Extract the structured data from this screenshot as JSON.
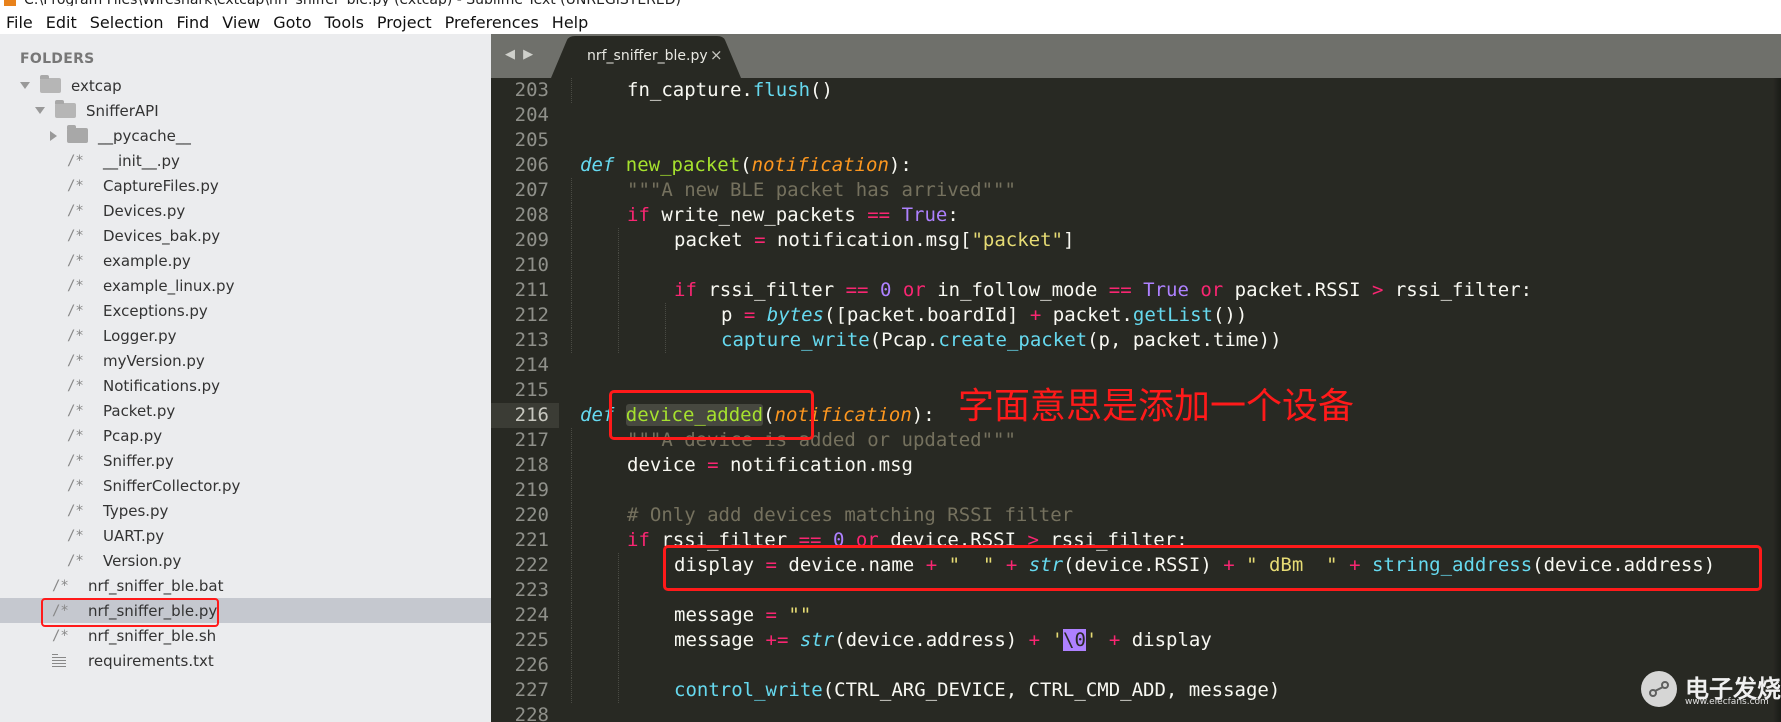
{
  "window": {
    "title": "C:\\Program Files\\Wireshark\\extcap\\nrf_sniffer_ble.py (extcap) - Sublime Text (UNREGISTERED)"
  },
  "menu": [
    "File",
    "Edit",
    "Selection",
    "Find",
    "View",
    "Goto",
    "Tools",
    "Project",
    "Preferences",
    "Help"
  ],
  "sidebar": {
    "heading": "FOLDERS",
    "items": [
      {
        "label": "extcap",
        "type": "folder-open",
        "depth": 0
      },
      {
        "label": "SnifferAPI",
        "type": "folder-open",
        "depth": 1
      },
      {
        "label": "__pycache__",
        "type": "folder-closed",
        "depth": 2
      },
      {
        "label": "__init__.py",
        "type": "file",
        "depth": 2
      },
      {
        "label": "CaptureFiles.py",
        "type": "file",
        "depth": 2
      },
      {
        "label": "Devices.py",
        "type": "file",
        "depth": 2
      },
      {
        "label": "Devices_bak.py",
        "type": "file",
        "depth": 2
      },
      {
        "label": "example.py",
        "type": "file",
        "depth": 2
      },
      {
        "label": "example_linux.py",
        "type": "file",
        "depth": 2
      },
      {
        "label": "Exceptions.py",
        "type": "file",
        "depth": 2
      },
      {
        "label": "Logger.py",
        "type": "file",
        "depth": 2
      },
      {
        "label": "myVersion.py",
        "type": "file",
        "depth": 2
      },
      {
        "label": "Notifications.py",
        "type": "file",
        "depth": 2
      },
      {
        "label": "Packet.py",
        "type": "file",
        "depth": 2
      },
      {
        "label": "Pcap.py",
        "type": "file",
        "depth": 2
      },
      {
        "label": "Sniffer.py",
        "type": "file",
        "depth": 2
      },
      {
        "label": "SnifferCollector.py",
        "type": "file",
        "depth": 2
      },
      {
        "label": "Types.py",
        "type": "file",
        "depth": 2
      },
      {
        "label": "UART.py",
        "type": "file",
        "depth": 2
      },
      {
        "label": "Version.py",
        "type": "file",
        "depth": 2
      },
      {
        "label": "nrf_sniffer_ble.bat",
        "type": "file",
        "depth": 1
      },
      {
        "label": "nrf_sniffer_ble.py",
        "type": "file",
        "depth": 1,
        "selected": true
      },
      {
        "label": "nrf_sniffer_ble.sh",
        "type": "file",
        "depth": 1
      },
      {
        "label": "requirements.txt",
        "type": "text",
        "depth": 1
      }
    ],
    "file_icon_glyph": "/*"
  },
  "editor": {
    "nav_arrows": "◀ ▶",
    "tab": {
      "title": "nrf_sniffer_ble.py",
      "close": "×"
    },
    "current_line": 216,
    "lines": [
      {
        "n": 203,
        "indent": 1,
        "tokens": [
          [
            "",
            "fn_capture."
          ],
          [
            "call",
            "flush"
          ],
          [
            "",
            "()"
          ]
        ]
      },
      {
        "n": 204,
        "indent": 0,
        "tokens": []
      },
      {
        "n": 205,
        "indent": 0,
        "tokens": []
      },
      {
        "n": 206,
        "indent": 0,
        "tokens": [
          [
            "def",
            "def"
          ],
          [
            "",
            " "
          ],
          [
            "fn",
            "new_packet"
          ],
          [
            "",
            "("
          ],
          [
            "param",
            "notification"
          ],
          [
            "",
            "):"
          ]
        ]
      },
      {
        "n": 207,
        "indent": 1,
        "tokens": [
          [
            "cmt",
            "\"\"\"A new BLE packet has arrived\"\"\""
          ]
        ]
      },
      {
        "n": 208,
        "indent": 1,
        "tokens": [
          [
            "kw",
            "if"
          ],
          [
            "",
            " write_new_packets "
          ],
          [
            "kw",
            "=="
          ],
          [
            "",
            " "
          ],
          [
            "const",
            "True"
          ],
          [
            "",
            ":"
          ]
        ]
      },
      {
        "n": 209,
        "indent": 2,
        "tokens": [
          [
            "",
            "packet "
          ],
          [
            "kw",
            "="
          ],
          [
            "",
            " notification.msg["
          ],
          [
            "str",
            "\"packet\""
          ],
          [
            "",
            "]"
          ]
        ]
      },
      {
        "n": 210,
        "indent": 0,
        "tokens": []
      },
      {
        "n": 211,
        "indent": 2,
        "tokens": [
          [
            "kw",
            "if"
          ],
          [
            "",
            " rssi_filter "
          ],
          [
            "kw",
            "=="
          ],
          [
            "",
            " "
          ],
          [
            "const",
            "0"
          ],
          [
            "",
            " "
          ],
          [
            "kw",
            "or"
          ],
          [
            "",
            " in_follow_mode "
          ],
          [
            "kw",
            "=="
          ],
          [
            "",
            " "
          ],
          [
            "const",
            "True"
          ],
          [
            "",
            " "
          ],
          [
            "kw",
            "or"
          ],
          [
            "",
            " packet.RSSI "
          ],
          [
            "kw",
            ">"
          ],
          [
            "",
            " rssi_filter:"
          ]
        ]
      },
      {
        "n": 212,
        "indent": 3,
        "tokens": [
          [
            "",
            "p "
          ],
          [
            "kw",
            "="
          ],
          [
            "",
            " "
          ],
          [
            "builtin",
            "bytes"
          ],
          [
            "",
            "([packet.boardId] "
          ],
          [
            "kw",
            "+"
          ],
          [
            "",
            " packet."
          ],
          [
            "call",
            "getList"
          ],
          [
            "",
            "())"
          ]
        ]
      },
      {
        "n": 213,
        "indent": 3,
        "tokens": [
          [
            "call",
            "capture_write"
          ],
          [
            "",
            "(Pcap."
          ],
          [
            "call",
            "create_packet"
          ],
          [
            "",
            "(p, packet.time))"
          ]
        ]
      },
      {
        "n": 214,
        "indent": 0,
        "tokens": []
      },
      {
        "n": 215,
        "indent": 0,
        "tokens": []
      },
      {
        "n": 216,
        "indent": 0,
        "tokens": [
          [
            "def",
            "def"
          ],
          [
            "",
            " "
          ],
          [
            "fn hl-word",
            "device_added"
          ],
          [
            "",
            "("
          ],
          [
            "param",
            "notification"
          ],
          [
            "",
            "):"
          ]
        ]
      },
      {
        "n": 217,
        "indent": 1,
        "tokens": [
          [
            "cmt",
            "\"\"\"A device is added or updated\"\"\""
          ]
        ]
      },
      {
        "n": 218,
        "indent": 1,
        "tokens": [
          [
            "",
            "device "
          ],
          [
            "kw",
            "="
          ],
          [
            "",
            " notification.msg"
          ]
        ]
      },
      {
        "n": 219,
        "indent": 0,
        "tokens": []
      },
      {
        "n": 220,
        "indent": 1,
        "tokens": [
          [
            "cmt",
            "# Only add devices matching RSSI filter"
          ]
        ]
      },
      {
        "n": 221,
        "indent": 1,
        "tokens": [
          [
            "kw",
            "if"
          ],
          [
            "",
            " rssi_filter "
          ],
          [
            "kw",
            "=="
          ],
          [
            "",
            " "
          ],
          [
            "const",
            "0"
          ],
          [
            "",
            " "
          ],
          [
            "kw",
            "or"
          ],
          [
            "",
            " device.RSSI "
          ],
          [
            "kw",
            ">"
          ],
          [
            "",
            " rssi_filter:"
          ]
        ]
      },
      {
        "n": 222,
        "indent": 2,
        "tokens": [
          [
            "",
            "display "
          ],
          [
            "kw",
            "="
          ],
          [
            "",
            " device.name "
          ],
          [
            "kw",
            "+"
          ],
          [
            "",
            " "
          ],
          [
            "str",
            "\"  \""
          ],
          [
            "",
            " "
          ],
          [
            "kw",
            "+"
          ],
          [
            "",
            " "
          ],
          [
            "builtin",
            "str"
          ],
          [
            "",
            "(device.RSSI) "
          ],
          [
            "kw",
            "+"
          ],
          [
            "",
            " "
          ],
          [
            "str",
            "\" dBm  \""
          ],
          [
            "",
            " "
          ],
          [
            "kw",
            "+"
          ],
          [
            "",
            " "
          ],
          [
            "call",
            "string_address"
          ],
          [
            "",
            "(device.address)"
          ]
        ]
      },
      {
        "n": 223,
        "indent": 0,
        "tokens": []
      },
      {
        "n": 224,
        "indent": 2,
        "tokens": [
          [
            "",
            "message "
          ],
          [
            "kw",
            "="
          ],
          [
            "",
            " "
          ],
          [
            "str",
            "\"\""
          ]
        ]
      },
      {
        "n": 225,
        "indent": 2,
        "tokens": [
          [
            "",
            "message "
          ],
          [
            "kw",
            "+="
          ],
          [
            "",
            " "
          ],
          [
            "builtin",
            "str"
          ],
          [
            "",
            "(device.address) "
          ],
          [
            "kw",
            "+"
          ],
          [
            "",
            " "
          ],
          [
            "str",
            "'"
          ],
          [
            "esc",
            "\\0"
          ],
          [
            "str",
            "'"
          ],
          [
            "",
            " "
          ],
          [
            "kw",
            "+"
          ],
          [
            "",
            " display"
          ]
        ]
      },
      {
        "n": 226,
        "indent": 0,
        "tokens": []
      },
      {
        "n": 227,
        "indent": 2,
        "tokens": [
          [
            "call",
            "control_write"
          ],
          [
            "",
            "(CTRL_ARG_DEVICE, CTRL_CMD_ADD, message)"
          ]
        ]
      },
      {
        "n": 228,
        "indent": 0,
        "tokens": []
      }
    ],
    "guides": {
      "207": [
        1
      ],
      "208": [
        1
      ],
      "209": [
        1,
        2
      ],
      "210": [
        1,
        2
      ],
      "211": [
        1,
        2
      ],
      "212": [
        1,
        2,
        3
      ],
      "213": [
        1,
        2,
        3
      ],
      "217": [
        1
      ],
      "218": [
        1
      ],
      "219": [
        1
      ],
      "220": [
        1
      ],
      "221": [
        1
      ],
      "222": [
        1,
        2
      ],
      "223": [
        1,
        2
      ],
      "224": [
        1,
        2
      ],
      "225": [
        1,
        2
      ],
      "226": [
        1,
        2
      ],
      "227": [
        1,
        2
      ],
      "203": [
        1
      ]
    }
  },
  "annotations": {
    "note": "字面意思是添加一个设备",
    "highlight_color": "#ff1a1a"
  },
  "watermark": {
    "brand": "电子发烧友",
    "url": "www.elecfans.com"
  },
  "colors": {
    "editor_bg": "#282923",
    "tabbar_bg": "#6f706b",
    "sidebar_bg": "#ebecee",
    "keyword": "#f92672",
    "function": "#a6e22e",
    "string": "#e6db74",
    "comment": "#75715e",
    "constant": "#ae81ff",
    "support": "#66d9ef",
    "parameter": "#fd971f"
  }
}
